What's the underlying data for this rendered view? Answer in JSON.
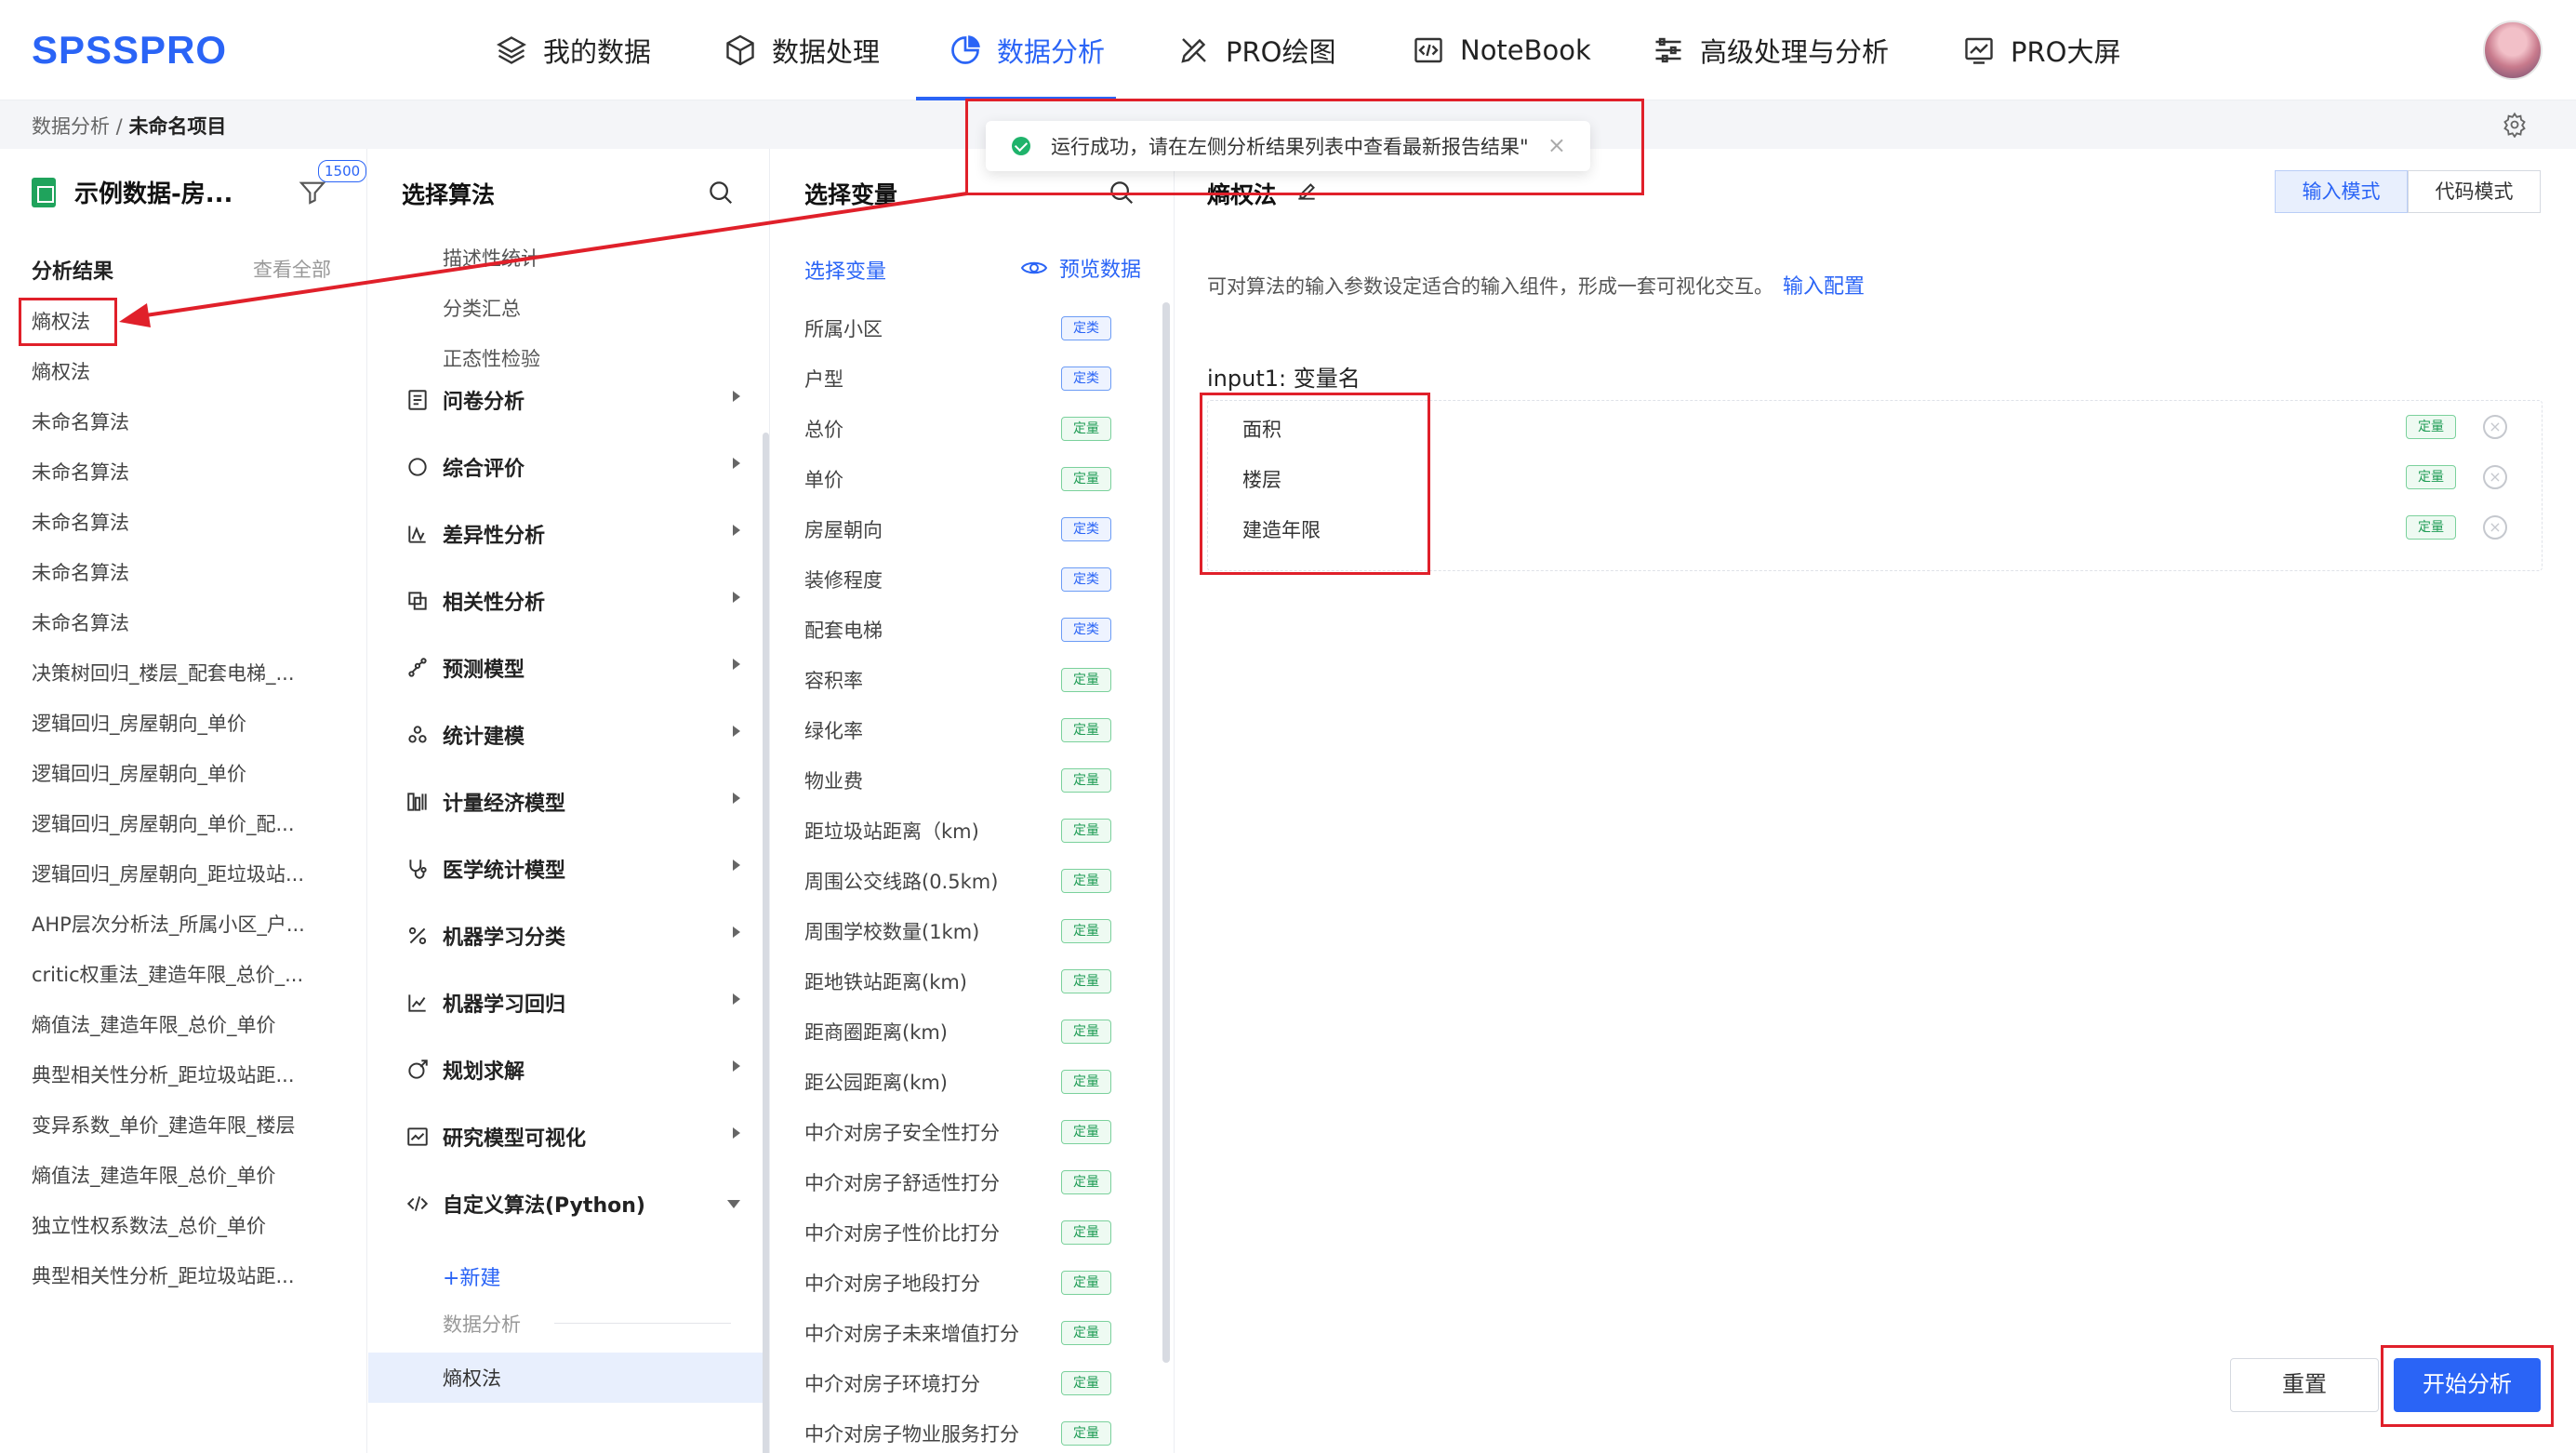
{
  "app": {
    "logo": "SPSSPRO"
  },
  "nav": {
    "items": [
      {
        "label": "我的数据",
        "icon": "layers-icon"
      },
      {
        "label": "数据处理",
        "icon": "cube-icon"
      },
      {
        "label": "数据分析",
        "icon": "pie-chart-icon",
        "active": true
      },
      {
        "label": "PRO绘图",
        "icon": "drawing-tools-icon"
      },
      {
        "label": "NoteBook",
        "icon": "code-icon"
      },
      {
        "label": "高级处理与分析",
        "icon": "sliders-icon"
      },
      {
        "label": "PRO大屏",
        "icon": "dashboard-icon"
      }
    ]
  },
  "breadcrumb": {
    "parent": "数据分析 / ",
    "current": "未命名项目"
  },
  "toast": {
    "message": "运行成功，请在左侧分析结果列表中查看最新报告结果\""
  },
  "sidebar": {
    "dataset_name": "示例数据-房...",
    "badge": "1500",
    "results_title": "分析结果",
    "view_all": "查看全部",
    "results": [
      "熵权法",
      "熵权法",
      "未命名算法",
      "未命名算法",
      "未命名算法",
      "未命名算法",
      "未命名算法",
      "决策树回归_楼层_配套电梯_...",
      "逻辑回归_房屋朝向_单价",
      "逻辑回归_房屋朝向_单价",
      "逻辑回归_房屋朝向_单价_配...",
      "逻辑回归_房屋朝向_距垃圾站...",
      "AHP层次分析法_所属小区_户...",
      "critic权重法_建造年限_总价_...",
      "熵值法_建造年限_总价_单价",
      "典型相关性分析_距垃圾站距...",
      "变异系数_单价_建造年限_楼层",
      "熵值法_建造年限_总价_单价",
      "独立性权系数法_总价_单价",
      "典型相关性分析_距垃圾站距..."
    ]
  },
  "algorithms": {
    "title": "选择算法",
    "subitems": [
      "描述性统计",
      "分类汇总",
      "正态性检验"
    ],
    "categories": [
      {
        "label": "问卷分析",
        "icon": "survey-icon"
      },
      {
        "label": "综合评价",
        "icon": "chat-icon"
      },
      {
        "label": "差异性分析",
        "icon": "difference-icon"
      },
      {
        "label": "相关性分析",
        "icon": "correlation-icon"
      },
      {
        "label": "预测模型",
        "icon": "prediction-icon"
      },
      {
        "label": "统计建模",
        "icon": "modeling-icon"
      },
      {
        "label": "计量经济模型",
        "icon": "econometrics-icon"
      },
      {
        "label": "医学统计模型",
        "icon": "stethoscope-icon"
      },
      {
        "label": "机器学习分类",
        "icon": "percent-icon"
      },
      {
        "label": "机器学习回归",
        "icon": "regression-icon"
      },
      {
        "label": "规划求解",
        "icon": "solver-icon"
      },
      {
        "label": "研究模型可视化",
        "icon": "visual-icon"
      },
      {
        "label": "自定义算法(Python)",
        "icon": "code-icon",
        "expanded": true
      }
    ],
    "new_label": "+新建",
    "group_label": "数据分析",
    "selected": "熵权法"
  },
  "variables": {
    "title": "选择变量",
    "tab": "选择变量",
    "preview": "预览数据",
    "items": [
      {
        "name": "所属小区",
        "type": "定类"
      },
      {
        "name": "户型",
        "type": "定类"
      },
      {
        "name": "总价",
        "type": "定量"
      },
      {
        "name": "单价",
        "type": "定量"
      },
      {
        "name": "房屋朝向",
        "type": "定类"
      },
      {
        "name": "装修程度",
        "type": "定类"
      },
      {
        "name": "配套电梯",
        "type": "定类"
      },
      {
        "name": "容积率",
        "type": "定量"
      },
      {
        "name": "绿化率",
        "type": "定量"
      },
      {
        "name": "物业费",
        "type": "定量"
      },
      {
        "name": "距垃圾站距离（km)",
        "type": "定量"
      },
      {
        "name": "周围公交线路(0.5km)",
        "type": "定量"
      },
      {
        "name": "周围学校数量(1km)",
        "type": "定量"
      },
      {
        "name": "距地铁站距离(km)",
        "type": "定量"
      },
      {
        "name": "距商圈距离(km)",
        "type": "定量"
      },
      {
        "name": "距公园距离(km)",
        "type": "定量"
      },
      {
        "name": "中介对房子安全性打分",
        "type": "定量"
      },
      {
        "name": "中介对房子舒适性打分",
        "type": "定量"
      },
      {
        "name": "中介对房子性价比打分",
        "type": "定量"
      },
      {
        "name": "中介对房子地段打分",
        "type": "定量"
      },
      {
        "name": "中介对房子未来增值打分",
        "type": "定量"
      },
      {
        "name": "中介对房子环境打分",
        "type": "定量"
      },
      {
        "name": "中介对房子物业服务打分",
        "type": "定量"
      }
    ]
  },
  "config": {
    "title": "熵权法",
    "mode_input": "输入模式",
    "mode_code": "代码模式",
    "description": "可对算法的输入参数设定适合的输入组件，形成一套可视化交互。",
    "input_config_link": "输入配置",
    "input_label": "input1:  变量名",
    "selected_vars": [
      {
        "name": "面积",
        "type": "定量"
      },
      {
        "name": "楼层",
        "type": "定量"
      },
      {
        "name": "建造年限",
        "type": "定量"
      }
    ],
    "reset": "重置",
    "start": "开始分析"
  },
  "colors": {
    "accent": "#2a64f6",
    "annotation": "#e0202a",
    "quantitative": "#1f9c55"
  }
}
